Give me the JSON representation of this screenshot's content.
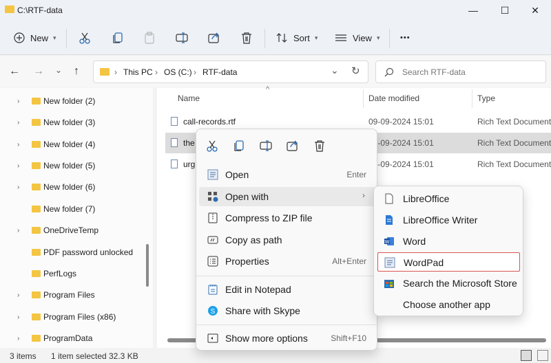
{
  "window": {
    "title": "C:\\RTF-data",
    "minimize_glyph": "—",
    "maximize_glyph": "☐",
    "close_glyph": "✕"
  },
  "toolbar": {
    "new_label": "New",
    "sort_label": "Sort",
    "view_label": "View",
    "more_glyph": "•••"
  },
  "nav": {
    "back_glyph": "←",
    "forward_glyph": "→",
    "recent_glyph": "⌄",
    "up_glyph": "↑",
    "breadcrumb": [
      "This PC",
      "OS (C:)",
      "RTF-data"
    ],
    "sep_glyph": "›",
    "dropdown_glyph": "⌄",
    "refresh_glyph": "↻",
    "search_placeholder": "Search RTF-data"
  },
  "sidebar": {
    "items": [
      {
        "label": "New folder (2)",
        "expandable": true
      },
      {
        "label": "New folder (3)",
        "expandable": true
      },
      {
        "label": "New folder (4)",
        "expandable": true
      },
      {
        "label": "New folder (5)",
        "expandable": true
      },
      {
        "label": "New folder (6)",
        "expandable": true
      },
      {
        "label": "New folder (7)",
        "expandable": false
      },
      {
        "label": "OneDriveTemp",
        "expandable": true
      },
      {
        "label": "PDF password unlocked",
        "expandable": false
      },
      {
        "label": "PerfLogs",
        "expandable": false
      },
      {
        "label": "Program Files",
        "expandable": true
      },
      {
        "label": "Program Files (x86)",
        "expandable": true
      },
      {
        "label": "ProgramData",
        "expandable": true
      }
    ],
    "arrow_glyph": "›"
  },
  "columns": {
    "name": "Name",
    "date": "Date modified",
    "type": "Type",
    "sort_glyph": "^"
  },
  "files": [
    {
      "name": "call-records.rtf",
      "date": "09-09-2024 15:01",
      "type": "Rich Text Document"
    },
    {
      "name": "the",
      "date": "09-09-2024 15:01",
      "type": "Rich Text Document"
    },
    {
      "name": "urg",
      "date": "09-09-2024 15:01",
      "type": "Rich Text Document"
    }
  ],
  "status": {
    "items": "3 items",
    "selected": "1 item selected",
    "size": "32.3 KB"
  },
  "context_menu": {
    "items": [
      {
        "label": "Open",
        "shortcut": "Enter"
      },
      {
        "label": "Open with",
        "submenu_glyph": "›"
      },
      {
        "label": "Compress to ZIP file"
      },
      {
        "label": "Copy as path"
      },
      {
        "label": "Properties",
        "shortcut": "Alt+Enter"
      },
      {
        "label": "Edit in Notepad"
      },
      {
        "label": "Share with Skype"
      },
      {
        "label": "Show more options",
        "shortcut": "Shift+F10"
      }
    ]
  },
  "open_with_menu": {
    "items": [
      {
        "label": "LibreOffice"
      },
      {
        "label": "LibreOffice Writer"
      },
      {
        "label": "Word"
      },
      {
        "label": "WordPad"
      },
      {
        "label": "Search the Microsoft Store"
      },
      {
        "label": "Choose another app"
      }
    ],
    "highlight_color": "#d9534f"
  }
}
